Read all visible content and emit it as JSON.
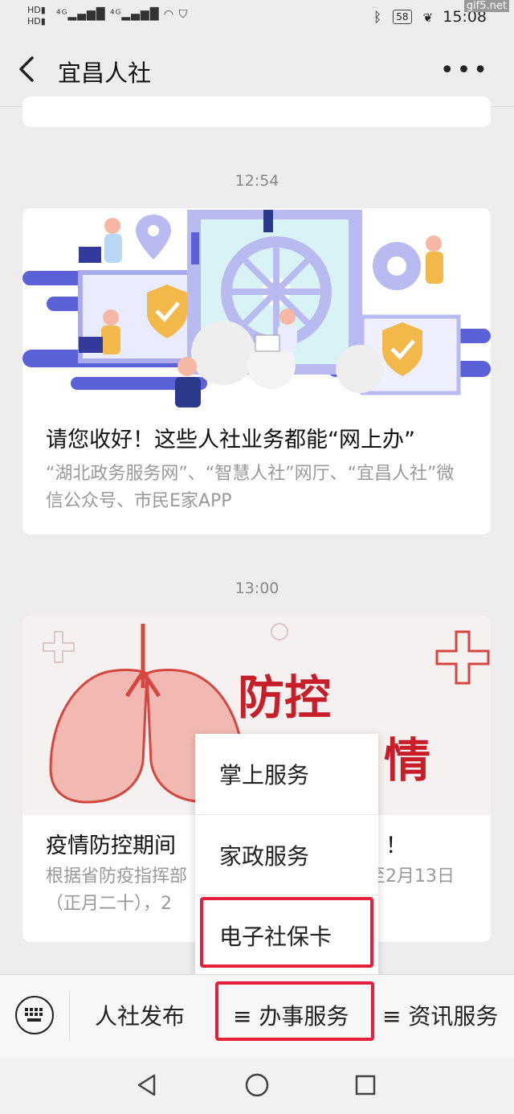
{
  "status_bar": {
    "network_labels": "HD 4G 4G",
    "battery": "58",
    "time": "15:08",
    "watermark": "gif5.net"
  },
  "header": {
    "title": "宜昌人社",
    "back_icon": "chevron-left-icon",
    "more_icon": "more-dots-icon"
  },
  "messages": [
    {
      "time": "12:54",
      "headline": "请您收好！这些人社业务都能“网上办”",
      "summary": "“湖北政务服务网”、“智慧人社”网厅、“宜昌人社”微信公众号、市民E家APP"
    },
    {
      "time": "13:00",
      "image_text": "防控",
      "image_text2": "情",
      "headline": "疫情防控期间",
      "headline_tail": "！",
      "summary_left": "根据省防疫指挥部",
      "summary_right": "至2月13日",
      "summary_line2": "（正月二十），2"
    }
  ],
  "popup_menu": {
    "items": [
      "掌上服务",
      "家政服务",
      "电子社保卡"
    ],
    "highlighted_index": 2
  },
  "bottom_menu": {
    "keyboard_icon": "keyboard-icon",
    "tabs": [
      "人社发布",
      "≡ 办事服务",
      "≡ 资讯服务"
    ],
    "active_index": 1
  },
  "colors": {
    "highlight": "#e31f3c",
    "illustration_blue": "#5b61d6",
    "shield_orange": "#f2b94a",
    "lung_red": "#d6453f"
  }
}
